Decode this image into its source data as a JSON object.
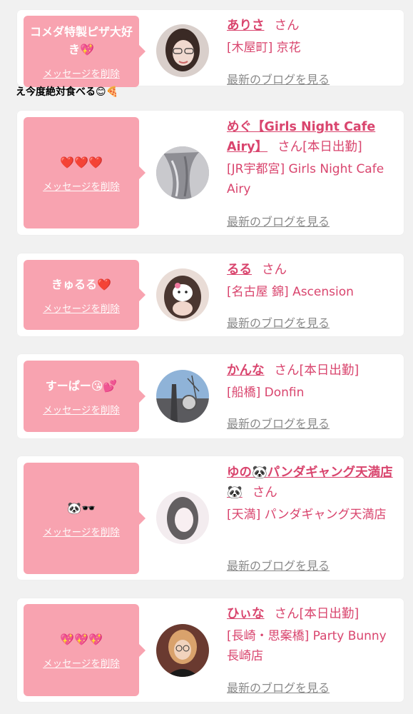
{
  "cards": [
    {
      "message": "コメダ特製ピザ大好き💖",
      "delete_label": "メッセージを削除",
      "name": "ありさ",
      "honorific": "さん",
      "status": "",
      "shop": "[木屋町] 京花",
      "blog_link": "最新のブログを見る"
    },
    {
      "message": "❤️❤️❤️",
      "delete_label": "メッセージを削除",
      "name": "めぐ【Girls Night Cafe Airy】",
      "honorific": "さん",
      "status": "[本日出勤]",
      "shop": "[JR宇都宮] Girls Night Cafe Airy",
      "blog_link": "最新のブログを見る"
    },
    {
      "message": "きゅるる❤️",
      "delete_label": "メッセージを削除",
      "name": "るる",
      "honorific": "さん",
      "status": "",
      "shop": "[名古屋 錦] Ascension",
      "blog_link": "最新のブログを見る"
    },
    {
      "message": "すーぱー😘💕",
      "delete_label": "メッセージを削除",
      "name": "かんな",
      "honorific": "さん",
      "status": "[本日出勤]",
      "shop": "[船橋] Donfin",
      "blog_link": "最新のブログを見る"
    },
    {
      "message": "🐼🕶️",
      "delete_label": "メッセージを削除",
      "name": "ゆの🐼パンダギャング天満店🐼",
      "honorific": "さん",
      "status": "",
      "shop": "[天満] パンダギャング天満店",
      "blog_link": "最新のブログを見る"
    },
    {
      "message": "💖💖💖",
      "delete_label": "メッセージを削除",
      "name": "ひぃな",
      "honorific": "さん",
      "status": "[本日出勤]",
      "shop": "[長崎・思案橋] Party Bunny 長崎店",
      "blog_link": "最新のブログを見る"
    }
  ],
  "overflow_message": "え今度絶対食べる😊🍕",
  "colors": {
    "accent": "#d9456e",
    "bubble": "#f8a3b0",
    "card_bg": "#ffffff",
    "page_bg": "#f1f1f1",
    "link_gray": "#8a8a8a"
  }
}
